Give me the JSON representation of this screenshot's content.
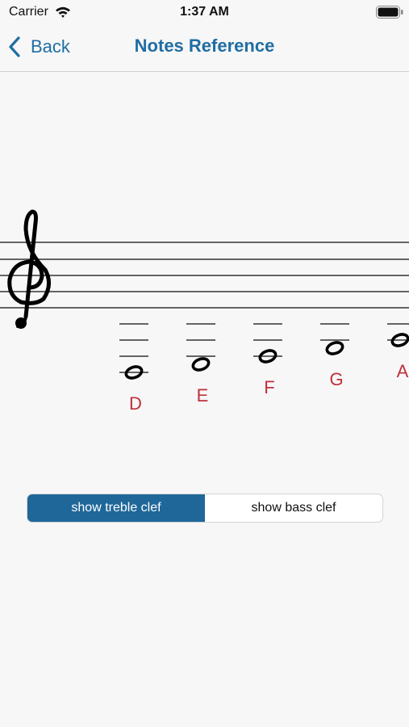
{
  "status_bar": {
    "carrier": "Carrier",
    "time": "1:37 AM",
    "icons": [
      "wifi-icon",
      "battery-icon"
    ]
  },
  "nav": {
    "back_label": "Back",
    "title": "Notes Reference",
    "back_icon": "chevron-left-icon"
  },
  "staff": {
    "clef": "treble-clef-icon",
    "notes": [
      {
        "name": "D"
      },
      {
        "name": "E"
      },
      {
        "name": "F"
      },
      {
        "name": "G"
      },
      {
        "name": "A"
      }
    ]
  },
  "segmented": {
    "options": [
      "show treble clef",
      "show bass clef"
    ],
    "selected_index": 0
  },
  "colors": {
    "accent": "#1f6ea3",
    "selected_segment": "#1f6799",
    "note_label": "#c0303c",
    "background": "#f7f7f7"
  }
}
